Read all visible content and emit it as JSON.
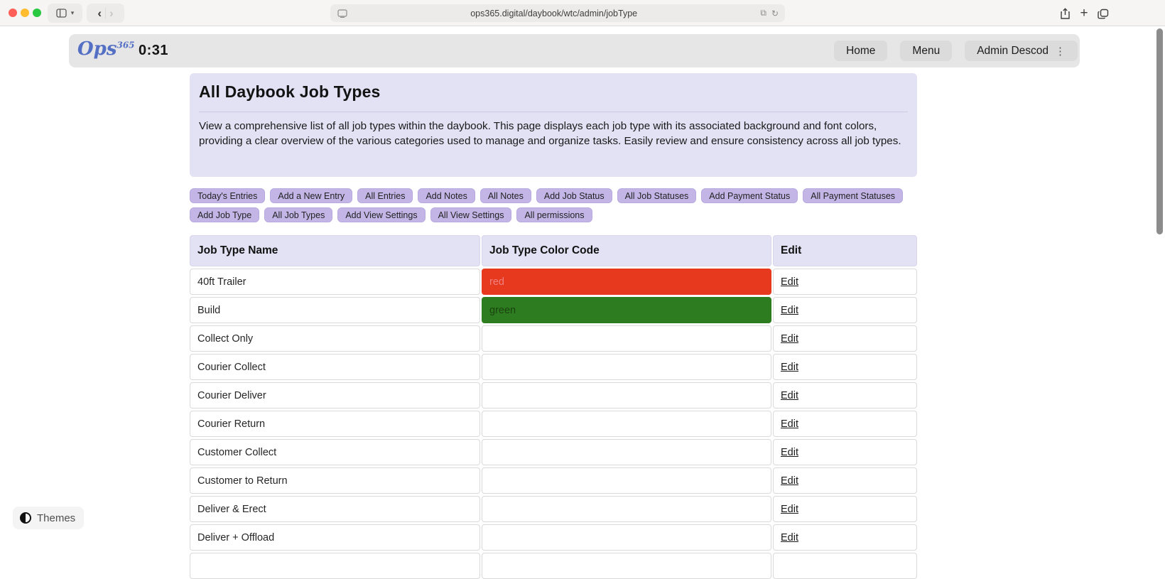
{
  "browser": {
    "url": "ops365.digital/daybook/wtc/admin/jobType",
    "traffic_lights": [
      "#ff5f57",
      "#febc2e",
      "#28c840"
    ]
  },
  "app_header": {
    "logo": {
      "text": "Ops",
      "sup": "365"
    },
    "timer": "0:31",
    "nav": [
      {
        "label": "Home",
        "has_menu": false
      },
      {
        "label": "Menu",
        "has_menu": false
      },
      {
        "label": "Admin Descod",
        "has_menu": true
      }
    ]
  },
  "intro": {
    "title": "All Daybook Job Types",
    "description": "View a comprehensive list of all job types within the daybook. This page displays each job type with its associated background and font colors, providing a clear overview of the various categories used to manage and organize tasks. Easily review and ensure consistency across all job types."
  },
  "toolbar": {
    "buttons": [
      "Today's Entries",
      "Add a New Entry",
      "All Entries",
      "Add Notes",
      "All Notes",
      "Add Job Status",
      "All Job Statuses",
      "Add Payment Status",
      "All Payment Statuses",
      "Add Job Type",
      "All Job Types",
      "Add View Settings",
      "All View Settings",
      "All permissions"
    ]
  },
  "table": {
    "columns": [
      "Job Type Name",
      "Job Type Color Code",
      "Edit"
    ],
    "edit_label": "Edit",
    "rows": [
      {
        "name": "40ft Trailer",
        "color_label": "red",
        "bg": "#e6391d",
        "fg": "#f08080"
      },
      {
        "name": "Build",
        "color_label": "green",
        "bg": "#2d7c20",
        "fg": "#1b440f"
      },
      {
        "name": "Collect Only",
        "color_label": "",
        "bg": "",
        "fg": ""
      },
      {
        "name": "Courier Collect",
        "color_label": "",
        "bg": "",
        "fg": ""
      },
      {
        "name": "Courier Deliver",
        "color_label": "",
        "bg": "",
        "fg": ""
      },
      {
        "name": "Courier Return",
        "color_label": "",
        "bg": "",
        "fg": ""
      },
      {
        "name": "Customer Collect",
        "color_label": "",
        "bg": "",
        "fg": ""
      },
      {
        "name": "Customer to Return",
        "color_label": "",
        "bg": "",
        "fg": ""
      },
      {
        "name": "Deliver & Erect",
        "color_label": "",
        "bg": "",
        "fg": ""
      },
      {
        "name": "Deliver + Offload",
        "color_label": "",
        "bg": "",
        "fg": ""
      }
    ],
    "has_partial_row": true
  },
  "themes": {
    "label": "Themes"
  },
  "colors": {
    "panel_lavender": "#e3e1f4",
    "accent_purple": "#c3b6e7",
    "header_gray": "#e7e6e6",
    "red_cell_bg": "#e6391d",
    "red_cell_fg": "#f08080",
    "green_cell_bg": "#2d7c20",
    "green_cell_fg": "#1b440f"
  }
}
